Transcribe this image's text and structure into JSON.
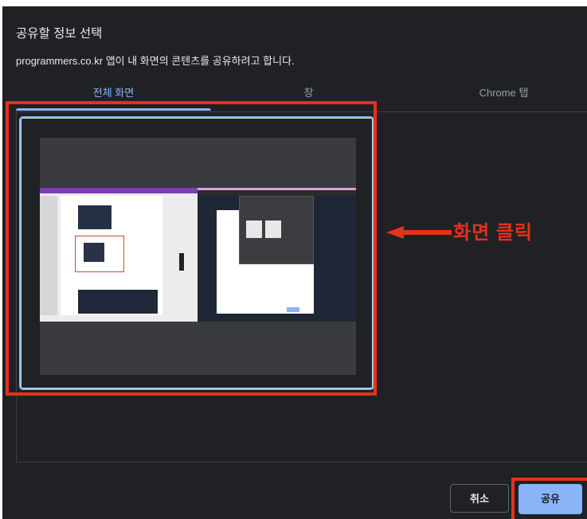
{
  "dialog": {
    "title": "공유할 정보 선택",
    "subtitle": "programmers.co.kr 앱이 내 화면의 콘텐츠를 공유하려고 합니다."
  },
  "tabs": [
    {
      "label": "전체 화면",
      "active": true
    },
    {
      "label": "창",
      "active": false
    },
    {
      "label": "Chrome 탭",
      "active": false
    }
  ],
  "annotation": {
    "text": "화면 클릭",
    "color": "#e5311b"
  },
  "buttons": {
    "cancel": "취소",
    "share": "공유"
  },
  "colors": {
    "dialog_bg": "#202124",
    "accent": "#8ab4f8",
    "text": "#e8eaed",
    "muted": "#9aa0a6"
  }
}
